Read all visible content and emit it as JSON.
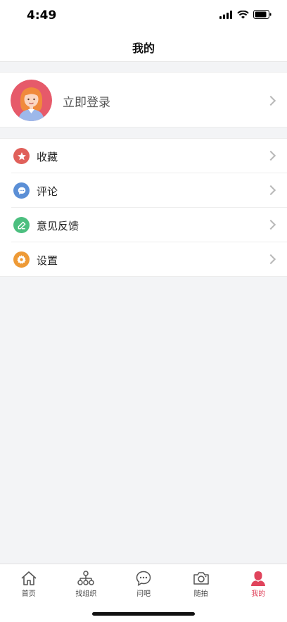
{
  "status": {
    "time": "4:49"
  },
  "nav": {
    "title": "我的"
  },
  "profile": {
    "login_label": "立即登录"
  },
  "menu": {
    "items": [
      {
        "label": "收藏",
        "icon": "star-icon",
        "color": "#e0605a"
      },
      {
        "label": "评论",
        "icon": "comment-icon",
        "color": "#5b8fd6"
      },
      {
        "label": "意见反馈",
        "icon": "edit-icon",
        "color": "#4cbf7f"
      },
      {
        "label": "设置",
        "icon": "gear-icon",
        "color": "#ee9a36"
      }
    ]
  },
  "tabs": [
    {
      "label": "首页",
      "icon": "home-icon"
    },
    {
      "label": "找组织",
      "icon": "org-icon"
    },
    {
      "label": "问吧",
      "icon": "chat-icon"
    },
    {
      "label": "随拍",
      "icon": "camera-icon"
    },
    {
      "label": "我的",
      "icon": "user-icon",
      "active": true
    }
  ],
  "colors": {
    "accent": "#e0445c",
    "background": "#f3f4f6"
  }
}
